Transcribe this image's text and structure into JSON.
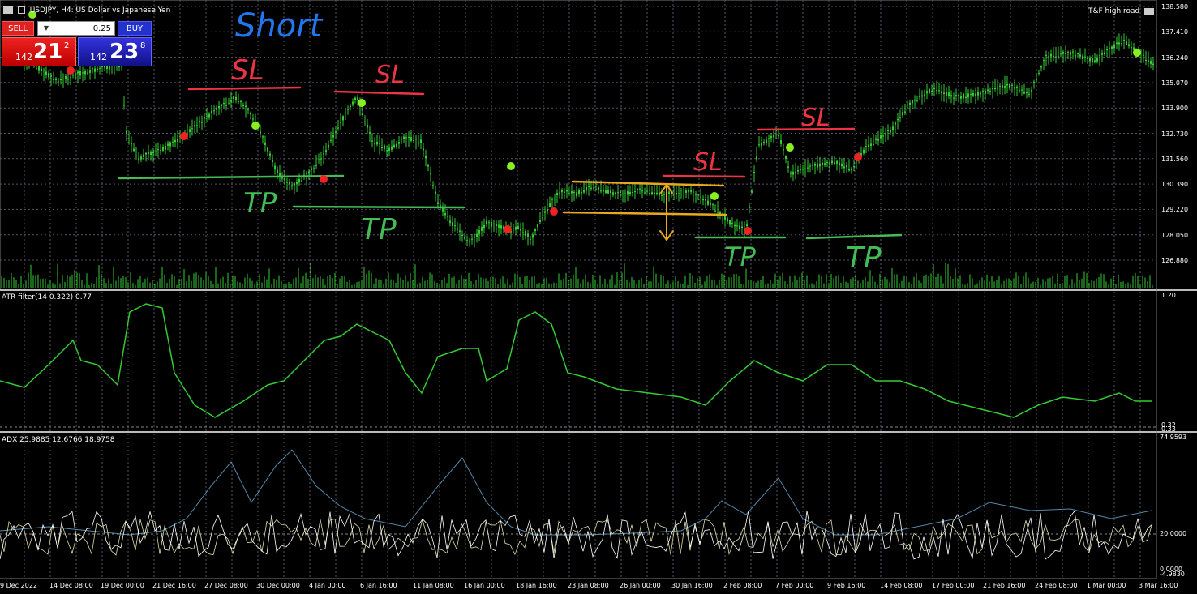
{
  "header": {
    "symbol_title": "USDJPY, H4:  US Dollar vs Japanese Yen",
    "indicator_name": "T&F high road"
  },
  "trade_panel": {
    "sell_label": "SELL",
    "buy_label": "BUY",
    "lot_value": "0.25",
    "sell_price": {
      "prefix": "142",
      "big": "21",
      "sup": "2"
    },
    "buy_price": {
      "prefix": "142",
      "big": "23",
      "sup": "8"
    }
  },
  "annotations": {
    "short": "Short",
    "sl": "SL",
    "tp": "TP"
  },
  "price_axis": [
    "138.580",
    "137.410",
    "136.240",
    "135.070",
    "133.900",
    "132.730",
    "131.560",
    "130.390",
    "129.220",
    "128.050",
    "126.880"
  ],
  "atr_panel": {
    "label": "ATR filter(14 0.322) 0.77",
    "axis_top": "1.20",
    "axis_bottom": "0.32",
    "axis_bottom2": "0.33"
  },
  "adx_panel": {
    "label": "ADX 25.9885 12.6766 18.9758",
    "axis_top": "74.9593",
    "axis_mid": "20.0000",
    "axis_bottom": "0.0000",
    "axis_bottom2": "-4.9830"
  },
  "time_axis": [
    "9 Dec 2022",
    "14 Dec 08:00",
    "19 Dec 00:00",
    "21 Dec 16:00",
    "27 Dec 08:00",
    "30 Dec 00:00",
    "4 Jan 00:00",
    "6 Jan 16:00",
    "11 Jan 08:00",
    "16 Jan 00:00",
    "18 Jan 16:00",
    "23 Jan 08:00",
    "26 Jan 00:00",
    "30 Jan 16:00",
    "2 Feb 08:00",
    "7 Feb 00:00",
    "9 Feb 16:00",
    "14 Feb 08:00",
    "17 Feb 00:00",
    "21 Feb 16:00",
    "24 Feb 08:00",
    "1 Mar 00:00",
    "3 Mar 16:00"
  ],
  "colors": {
    "candle": "#33cc33",
    "sl_line": "#ee3344",
    "tp_line": "#44bb55",
    "range_box": "#e8a820",
    "short_text": "#2277ee",
    "dot_red": "#ee2222",
    "dot_green": "#88ee22",
    "adx_line": "#5588aa",
    "di_plus": "#ddddaa",
    "di_minus": "#ffffff"
  }
}
